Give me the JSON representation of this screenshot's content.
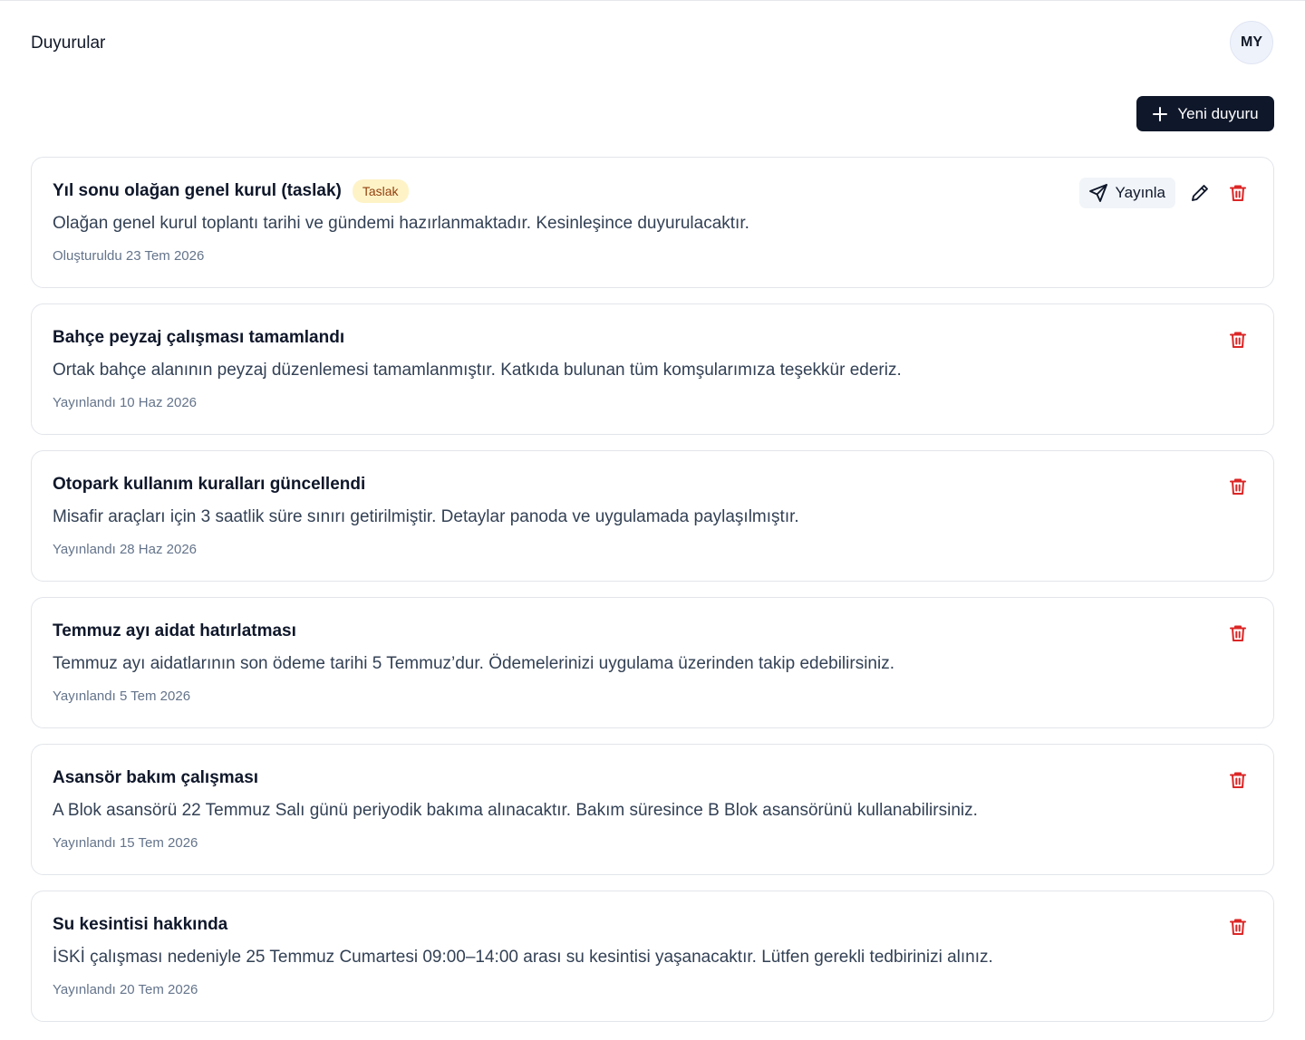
{
  "header": {
    "title": "Duyurular",
    "avatar_initials": "MY"
  },
  "toolbar": {
    "new_label": "Yeni duyuru",
    "new_icon": "plus-icon"
  },
  "colors": {
    "primary": "#0f172a",
    "danger": "#dc2626",
    "draft_badge_bg": "#fef3c7",
    "draft_badge_text": "#92400e"
  },
  "announcements": [
    {
      "title": "Yıl sonu olağan genel kurul (taslak)",
      "badge": "Taslak",
      "body": "Olağan genel kurul toplantı tarihi ve gündemi hazırlanmaktadır. Kesinleşince duyurulacaktır.",
      "meta": "Oluşturuldu 23 Tem 2026",
      "publish_label": "Yayınla",
      "draft": true
    },
    {
      "title": "Bahçe peyzaj çalışması tamamlandı",
      "body": "Ortak bahçe alanının peyzaj düzenlemesi tamamlanmıştır. Katkıda bulunan tüm komşularımıza teşekkür ederiz.",
      "meta": "Yayınlandı 10 Haz 2026",
      "draft": false
    },
    {
      "title": "Otopark kullanım kuralları güncellendi",
      "body": "Misafir araçları için 3 saatlik süre sınırı getirilmiştir. Detaylar panoda ve uygulamada paylaşılmıştır.",
      "meta": "Yayınlandı 28 Haz 2026",
      "draft": false
    },
    {
      "title": "Temmuz ayı aidat hatırlatması",
      "body": "Temmuz ayı aidatlarının son ödeme tarihi 5 Temmuz’dur. Ödemelerinizi uygulama üzerinden takip edebilirsiniz.",
      "meta": "Yayınlandı 5 Tem 2026",
      "draft": false
    },
    {
      "title": "Asansör bakım çalışması",
      "body": "A Blok asansörü 22 Temmuz Salı günü periyodik bakıma alınacaktır. Bakım süresince B Blok asansörünü kullanabilirsiniz.",
      "meta": "Yayınlandı 15 Tem 2026",
      "draft": false
    },
    {
      "title": "Su kesintisi hakkında",
      "body": "İSKİ çalışması nedeniyle 25 Temmuz Cumartesi 09:00–14:00 arası su kesintisi yaşanacaktır. Lütfen gerekli tedbirinizi alınız.",
      "meta": "Yayınlandı 20 Tem 2026",
      "draft": false
    }
  ]
}
